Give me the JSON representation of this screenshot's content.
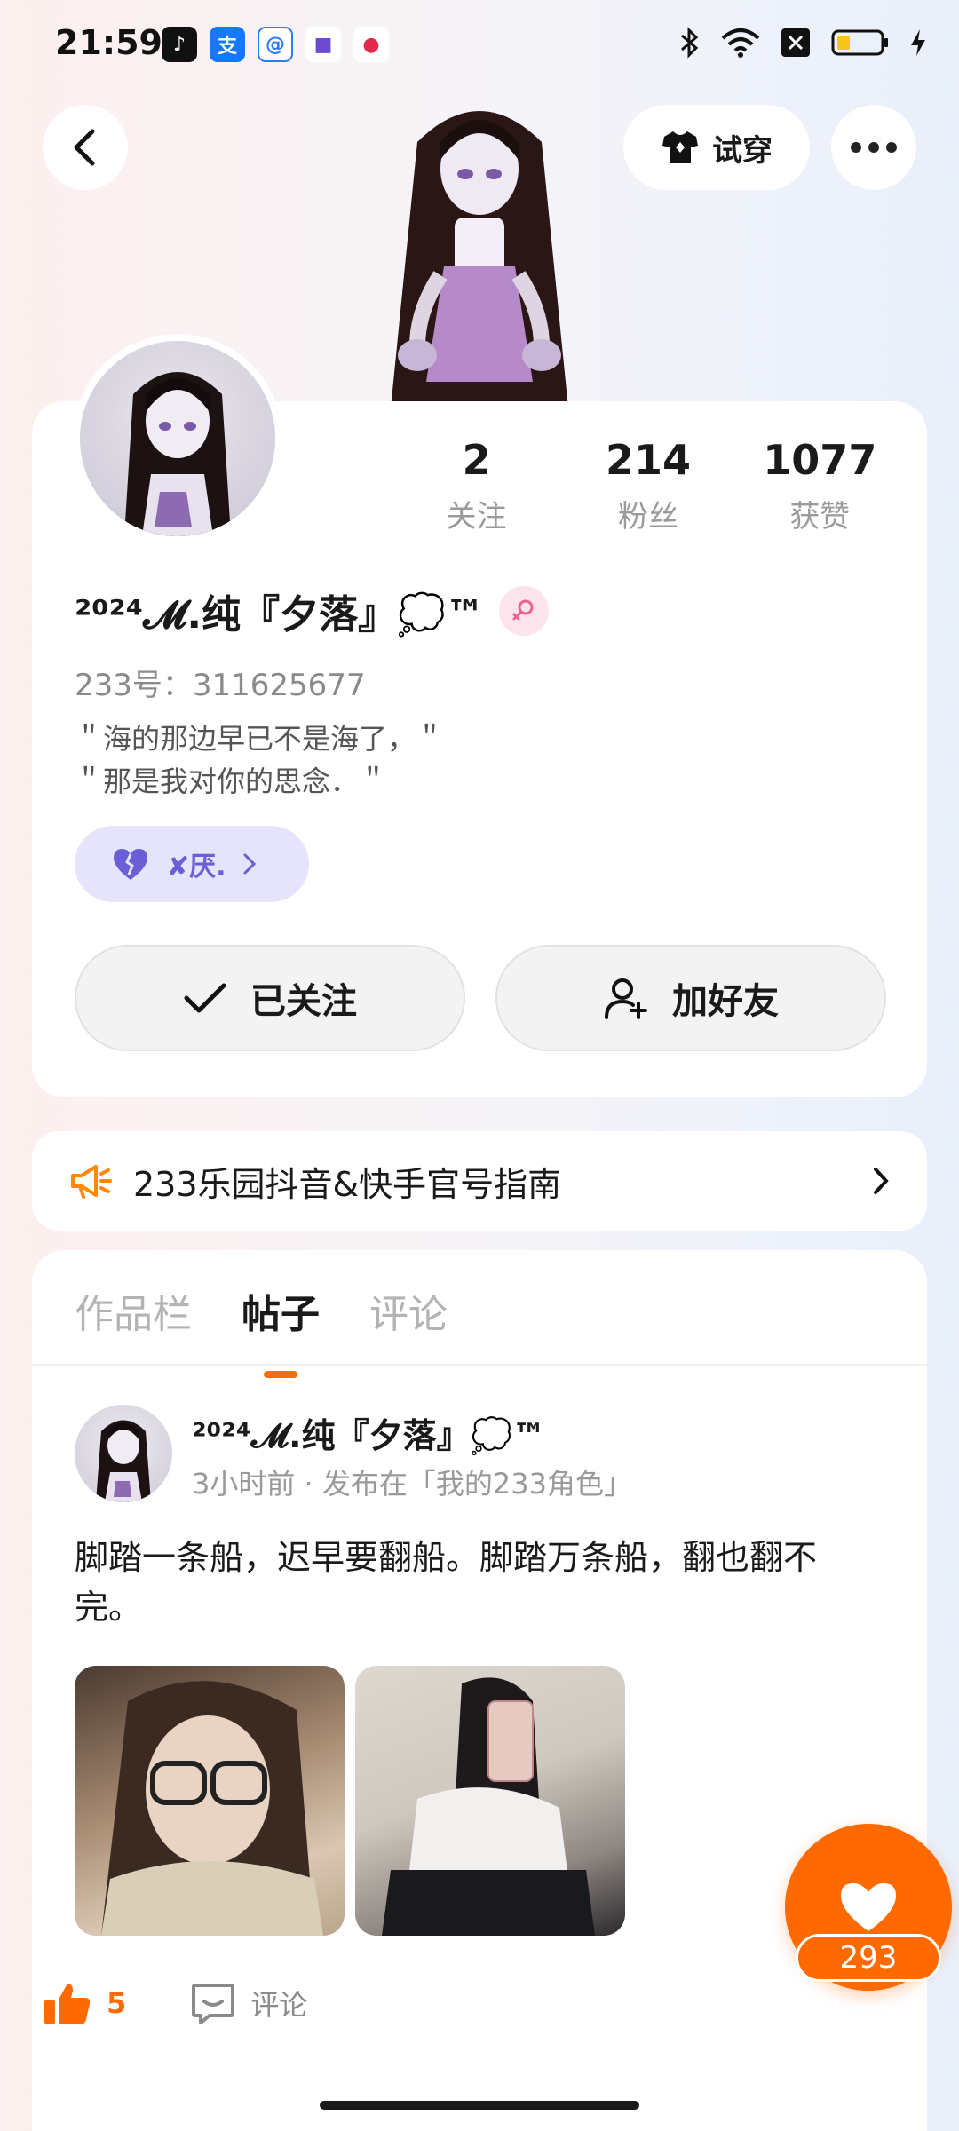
{
  "status_bar": {
    "time": "21:59",
    "app_icons": [
      "tiktok-icon",
      "alipay-icon",
      "browser-icon",
      "app-icon",
      "game-icon"
    ]
  },
  "header": {
    "try_on_label": "试穿"
  },
  "profile": {
    "stats": [
      {
        "value": "2",
        "label": "关注"
      },
      {
        "value": "214",
        "label": "粉丝"
      },
      {
        "value": "1077",
        "label": "获赞"
      }
    ],
    "name": "²⁰²⁴𝓜.纯『夕落』💭™",
    "uid": "233号：311625677",
    "bio": [
      "＂海的那边早已不是海了，＂",
      "＂那是我对你的思念．＂"
    ],
    "tag_label": "✘厌.",
    "followed_label": "已关注",
    "add_friend_label": "加好友"
  },
  "notice": {
    "text": "233乐园抖音&快手官号指南"
  },
  "tabs": [
    "作品栏",
    "帖子",
    "评论"
  ],
  "post": {
    "author": "²⁰²⁴𝓜.纯『夕落』💭™",
    "meta": "3小时前 · 发布在「我的233角色」",
    "text": "脚踏一条船，迟早要翻船。脚踏万条船，翻也翻不完。",
    "like_count": "5",
    "comment_label": "评论"
  },
  "float_like": {
    "count": "293"
  },
  "colors": {
    "accent": "#ff6a00",
    "tag_bg": "#e6e4fb",
    "tag_fg": "#6a5fd6"
  }
}
